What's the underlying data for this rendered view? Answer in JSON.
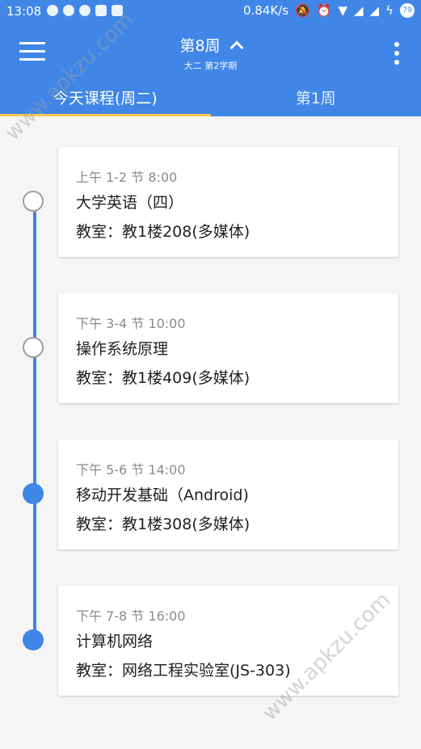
{
  "status_bar": {
    "time": "13:08",
    "network_speed": "0.84K/s",
    "battery": "79"
  },
  "app_bar": {
    "title": "第8周",
    "subtitle": "大二 第2学期",
    "color": "#3f86e6"
  },
  "tabs": [
    {
      "label": "今天课程(周二)",
      "active": true
    },
    {
      "label": "第1周",
      "active": false
    }
  ],
  "courses": [
    {
      "time": "上午 1-2 节 8:00",
      "name": "大学英语（四）",
      "room": "教室：教1楼208(多媒体)",
      "state": "upcoming"
    },
    {
      "time": "下午 3-4 节 10:00",
      "name": "操作系统原理",
      "room": "教室：教1楼409(多媒体)",
      "state": "upcoming"
    },
    {
      "time": "下午 5-6 节 14:00",
      "name": "移动开发基础（Android)",
      "room": "教室：教1楼308(多媒体)",
      "state": "done"
    },
    {
      "time": "下午 7-8 节 16:00",
      "name": "计算机网络",
      "room": "教室：网络工程实验室(JS-303)",
      "state": "done"
    }
  ],
  "watermark": "www.apkzu.com"
}
